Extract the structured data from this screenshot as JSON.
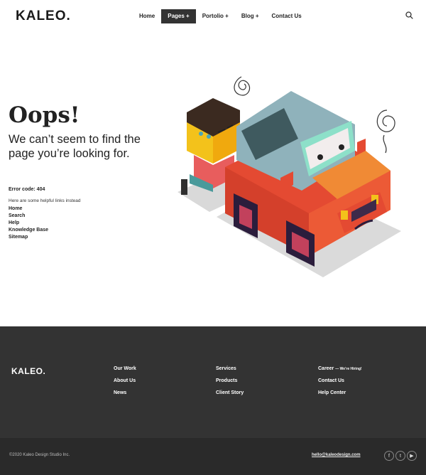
{
  "header": {
    "logo": "KALEO.",
    "nav": [
      "Home",
      "Pages +",
      "Portolio +",
      "Blog +",
      "Contact Us"
    ],
    "active_index": 1,
    "search_icon": "search-icon"
  },
  "error": {
    "title": "Oops!",
    "message": "We can’t seem to find the page you’re looking for.",
    "code": "Error code: 404",
    "help_text": "Here are some helpful links instead",
    "links": [
      "Home",
      "Search",
      "Help",
      "Knowledge Base",
      "Sitemap"
    ]
  },
  "footer": {
    "logo": "KALEO.",
    "col1": [
      "Our Work",
      "About Us",
      "News"
    ],
    "col2": [
      "Services",
      "Products",
      "Client Story"
    ],
    "col3": {
      "career": "Career",
      "hiring": "— We’re Hiring!",
      "items": [
        "Contact Us",
        "Help Center"
      ]
    },
    "copyright": "©2020 Kaleo Design Studio Inc.",
    "email": "hello@kaleodesign.com",
    "social_icons": [
      "facebook-icon",
      "twitter-icon",
      "youtube-icon"
    ]
  },
  "colors": {
    "footer_bg": "#333333",
    "bottom_bg": "#2a2a2a",
    "nav_active_bg": "#333333"
  }
}
